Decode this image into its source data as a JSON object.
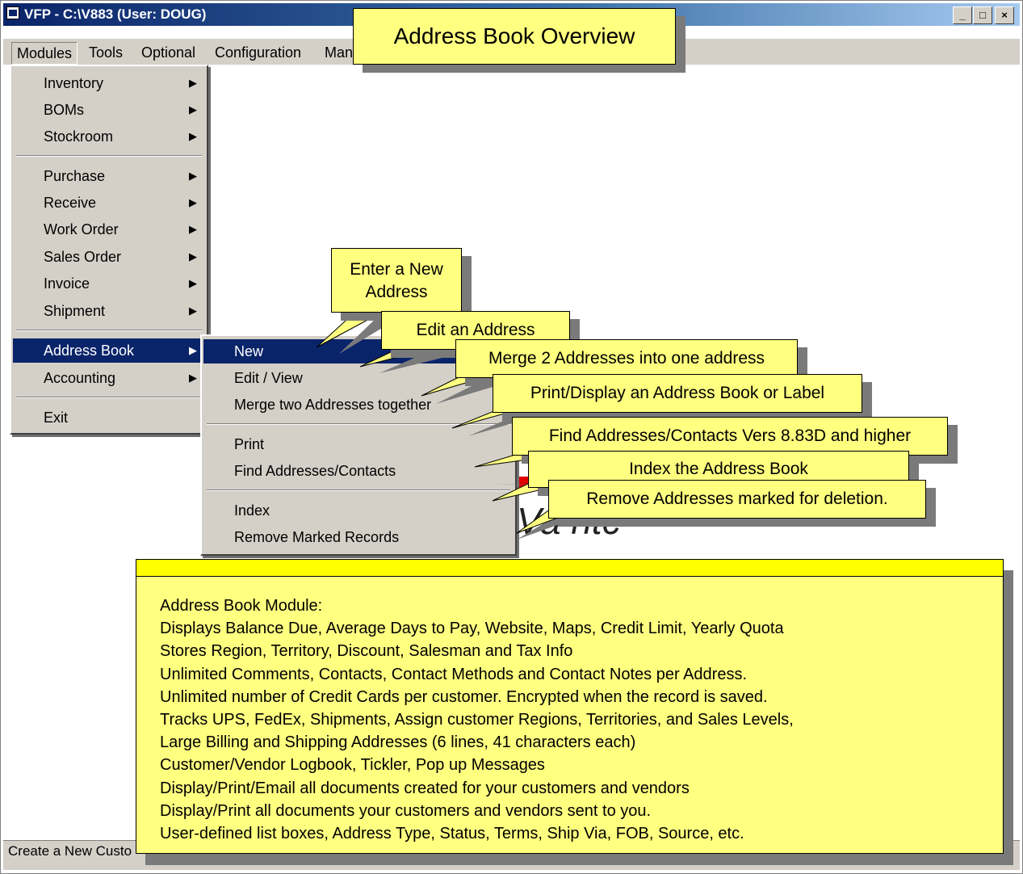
{
  "window": {
    "title": "VFP - C:\\V883  (User: DOUG)",
    "controls": {
      "minimize": "_",
      "maximize": "□",
      "close": "×"
    }
  },
  "menubar": {
    "items": [
      "Modules",
      "Tools",
      "Optional",
      "Configuration",
      "Man"
    ]
  },
  "modules_menu": {
    "items": [
      {
        "label": "Inventory",
        "submenu": true
      },
      {
        "label": "BOMs",
        "submenu": true
      },
      {
        "label": "Stockroom",
        "submenu": true
      },
      {
        "label": "Purchase",
        "submenu": true
      },
      {
        "label": "Receive",
        "submenu": true
      },
      {
        "label": "Work Order",
        "submenu": true
      },
      {
        "label": "Sales Order",
        "submenu": true
      },
      {
        "label": "Invoice",
        "submenu": true
      },
      {
        "label": "Shipment",
        "submenu": true
      },
      {
        "label": "Address Book",
        "submenu": true,
        "highlighted": true
      },
      {
        "label": "Accounting",
        "submenu": true
      },
      {
        "label": "Exit",
        "submenu": false
      }
    ],
    "arrow": "▶"
  },
  "address_book_submenu": {
    "items": [
      {
        "label": "New",
        "highlighted": true
      },
      {
        "label": "Edit / View"
      },
      {
        "label": "Merge two Addresses together"
      },
      {
        "label": "Print"
      },
      {
        "label": "Find Addresses/Contacts"
      },
      {
        "label": "Index"
      },
      {
        "label": "Remove Marked Records"
      }
    ]
  },
  "callouts": {
    "title": "Address Book Overview",
    "new_address": [
      "Enter a New",
      "Address"
    ],
    "edit": "Edit an Address",
    "merge": "Merge 2 Addresses into one address",
    "print": "Print/Display an Address Book or Label",
    "find": "Find Addresses/Contacts Vers 8.83D and higher",
    "index": "Index the Address Book",
    "remove": "Remove Addresses marked for deletion."
  },
  "overview_box": {
    "lines": [
      "Address Book Module:",
      "Displays Balance Due, Average Days to Pay, Website, Maps, Credit Limit, Yearly Quota",
      "Stores Region, Territory, Discount, Salesman and Tax Info",
      "Unlimited Comments, Contacts, Contact Methods and Contact Notes per Address.",
      "Unlimited number of Credit Cards per customer.  Encrypted when the record is saved.",
      "Tracks UPS, FedEx, Shipments, Assign customer Regions, Territories, and Sales Levels,",
      "Large Billing and Shipping Addresses (6 lines, 41 characters each)",
      "Customer/Vendor Logbook, Tickler, Pop up Messages",
      "Display/Print/Email all documents created for your customers and vendors",
      "Display/Print all documents your customers and vendors sent to you.",
      "User-defined list boxes, Address Type, Status, Terms, Ship Via, FOB, Source, etc."
    ]
  },
  "statusbar": {
    "text": "Create a New Custo"
  },
  "background_logo": "Va     ntc"
}
